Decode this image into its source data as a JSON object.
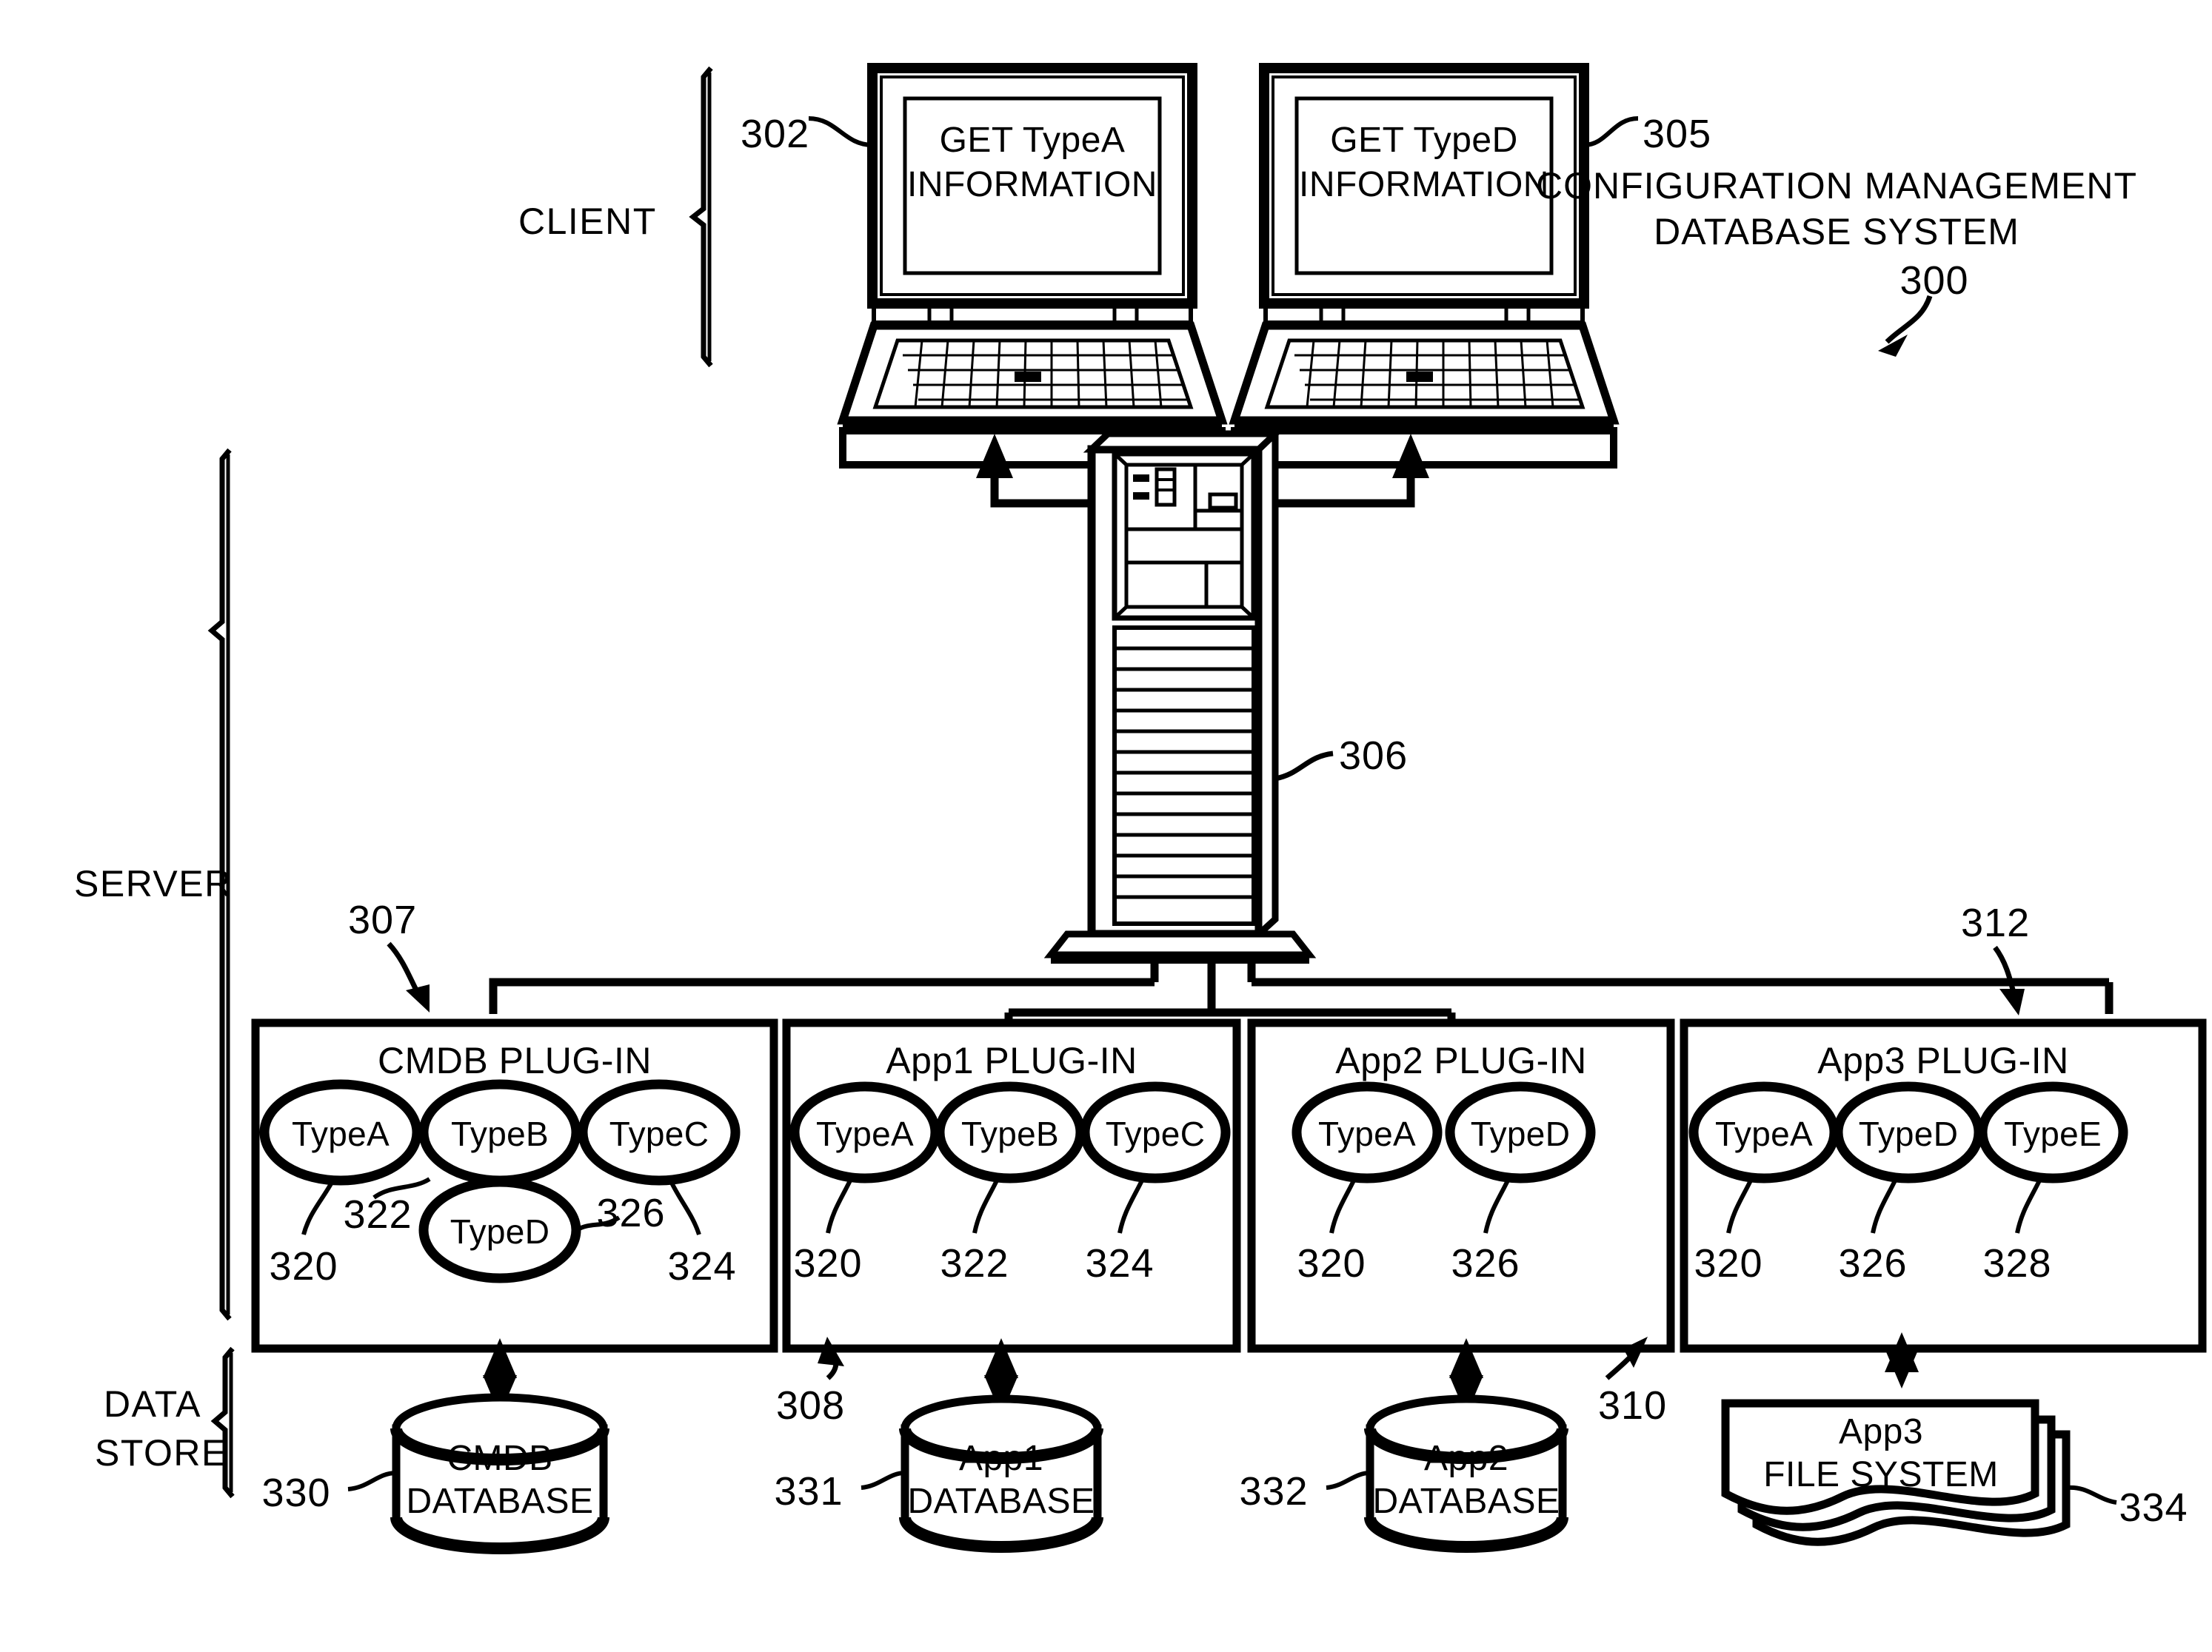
{
  "figure": {
    "system_title_line1": "CONFIGURATION MANAGEMENT",
    "system_title_line2": "DATABASE SYSTEM",
    "system_ref": "300"
  },
  "zones": [
    {
      "name": "client",
      "label": "CLIENT"
    },
    {
      "name": "server",
      "label": "SERVER"
    },
    {
      "name": "data-store",
      "label_line1": "DATA",
      "label_line2": "STORE"
    }
  ],
  "clients": [
    {
      "name": "client-laptop-typea",
      "screen_line1": "GET TypeA",
      "screen_line2": "INFORMATION",
      "ref": "302"
    },
    {
      "name": "client-laptop-typed",
      "screen_line1": "GET TypeD",
      "screen_line2": "INFORMATION",
      "ref": "305"
    }
  ],
  "server": {
    "name": "server-tower",
    "ref": "306"
  },
  "plugins": [
    {
      "name": "cmdb-plugin",
      "title": "CMDB PLUG-IN",
      "ref": "307",
      "layout": "cmdb",
      "types": [
        {
          "label": "TypeA",
          "ref": "320"
        },
        {
          "label": "TypeB",
          "ref": "322"
        },
        {
          "label": "TypeC",
          "ref": "324"
        },
        {
          "label": "TypeD",
          "ref": "326"
        }
      ]
    },
    {
      "name": "app1-plugin",
      "title": "App1 PLUG-IN",
      "ref": "308",
      "layout": "row",
      "types": [
        {
          "label": "TypeA",
          "ref": "320"
        },
        {
          "label": "TypeB",
          "ref": "322"
        },
        {
          "label": "TypeC",
          "ref": "324"
        }
      ]
    },
    {
      "name": "app2-plugin",
      "title": "App2 PLUG-IN",
      "ref": "310",
      "layout": "row",
      "types": [
        {
          "label": "TypeA",
          "ref": "320"
        },
        {
          "label": "TypeD",
          "ref": "326"
        }
      ]
    },
    {
      "name": "app3-plugin",
      "title": "App3 PLUG-IN",
      "ref": "312",
      "layout": "row",
      "types": [
        {
          "label": "TypeA",
          "ref": "320"
        },
        {
          "label": "TypeD",
          "ref": "326"
        },
        {
          "label": "TypeE",
          "ref": "328"
        }
      ]
    }
  ],
  "datastores": [
    {
      "name": "cmdb-database",
      "kind": "cylinder",
      "line1": "CMDB",
      "line2": "DATABASE",
      "ref": "330"
    },
    {
      "name": "app1-database",
      "kind": "cylinder",
      "line1": "App1",
      "line2": "DATABASE",
      "ref": "331"
    },
    {
      "name": "app2-database",
      "kind": "cylinder",
      "line1": "App2",
      "line2": "DATABASE",
      "ref": "332"
    },
    {
      "name": "app3-file-system",
      "kind": "document-stack",
      "line1": "App3",
      "line2": "FILE SYSTEM",
      "ref": "334"
    }
  ],
  "colors": {
    "ink": "#000000",
    "paper": "#ffffff"
  }
}
